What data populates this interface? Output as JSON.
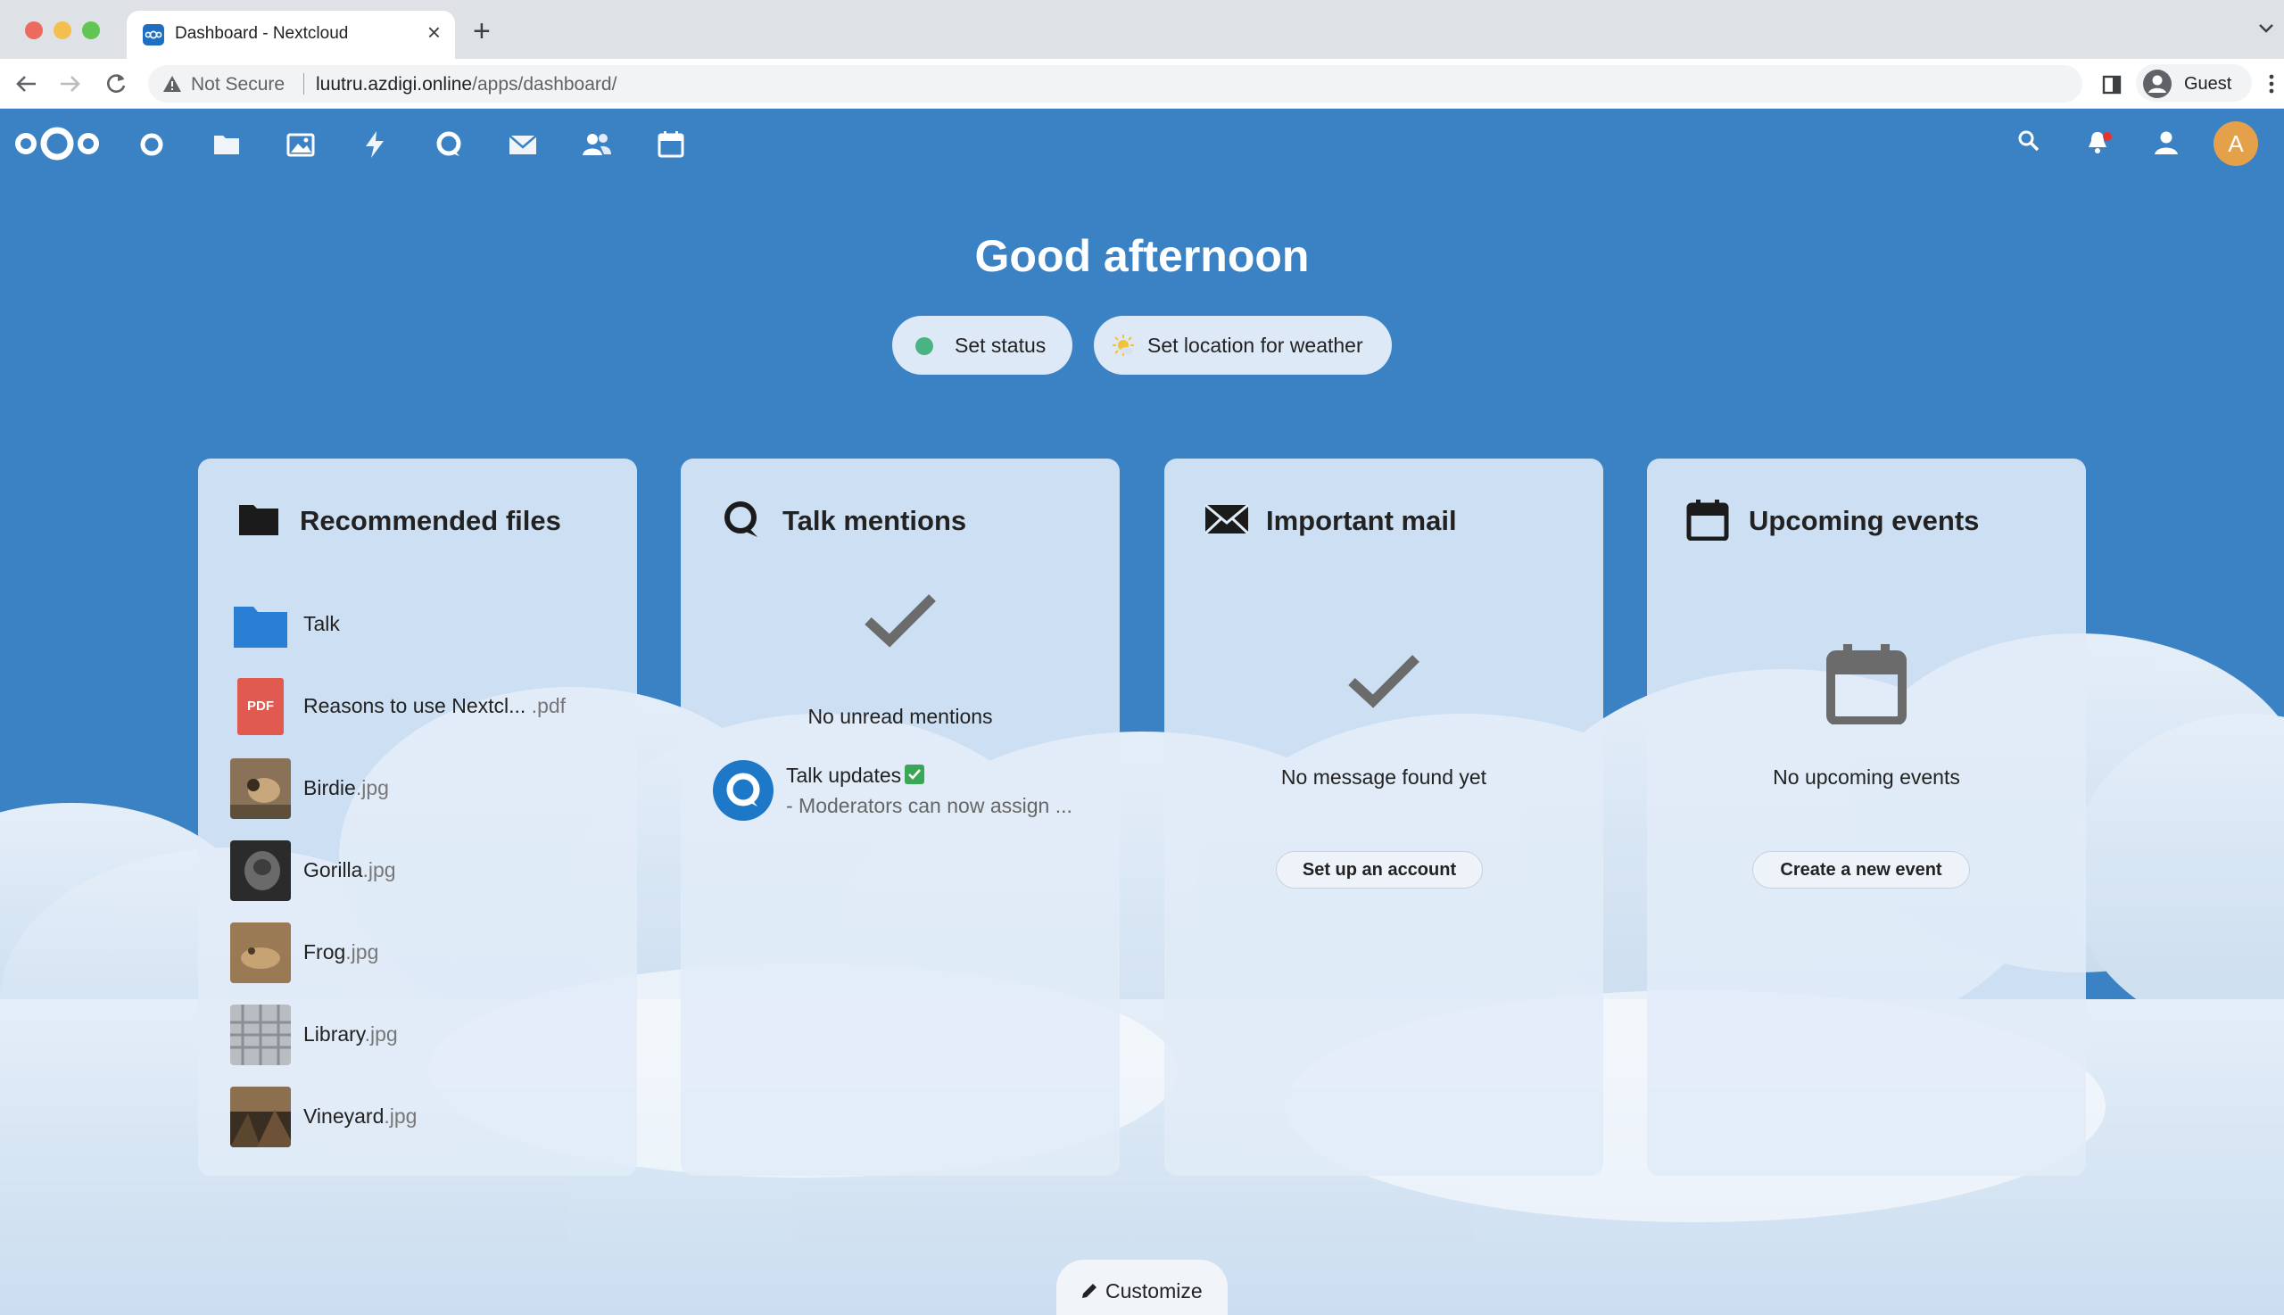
{
  "browser": {
    "tab_title": "Dashboard - Nextcloud",
    "security_label": "Not Secure",
    "url_host": "luutru.azdigi.online",
    "url_path": "/apps/dashboard/",
    "profile_name": "Guest"
  },
  "header": {
    "app_icons": [
      "dashboard-icon",
      "files-icon",
      "photos-icon",
      "activity-icon",
      "talk-icon",
      "mail-icon",
      "contacts-icon",
      "calendar-icon"
    ],
    "right_icons": [
      "search-icon",
      "notifications-icon",
      "contacts-menu-icon"
    ],
    "avatar_initial": "A",
    "accent_color": "#3b82c4"
  },
  "greeting": "Good afternoon",
  "status_button": "Set status",
  "weather_button": "Set location for weather",
  "widgets": {
    "files": {
      "title": "Recommended files",
      "items": [
        {
          "name": "Talk",
          "ext": ""
        },
        {
          "name": "Reasons to use Nextcl...",
          "ext": " .pdf"
        },
        {
          "name": "Birdie",
          "ext": ".jpg"
        },
        {
          "name": "Gorilla",
          "ext": ".jpg"
        },
        {
          "name": "Frog",
          "ext": ".jpg"
        },
        {
          "name": "Library",
          "ext": ".jpg"
        },
        {
          "name": "Vineyard",
          "ext": ".jpg"
        }
      ],
      "pdf_badge": "PDF"
    },
    "talk": {
      "title": "Talk mentions",
      "empty": "No unread mentions",
      "item_title": "Talk updates",
      "item_subtitle": "- Moderators can now assign ..."
    },
    "mail": {
      "title": "Important mail",
      "empty": "No message found yet",
      "action": "Set up an account"
    },
    "events": {
      "title": "Upcoming events",
      "empty": "No upcoming events",
      "action": "Create a new event"
    }
  },
  "customize_button": "Customize"
}
